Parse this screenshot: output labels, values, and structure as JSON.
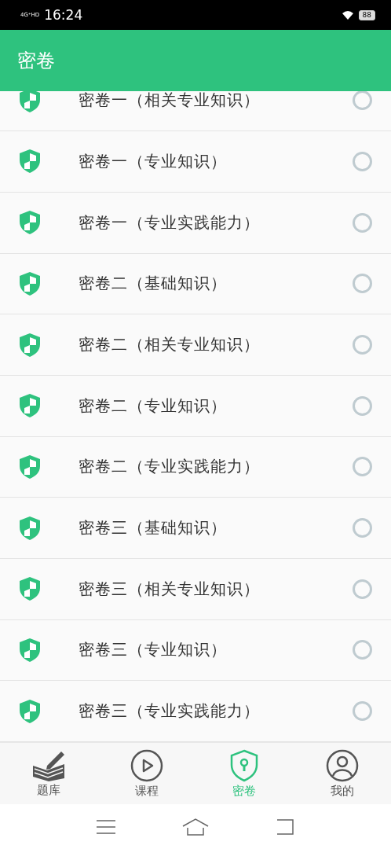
{
  "status_bar": {
    "network": "4G⁺HD",
    "time": "16:24",
    "battery": "88"
  },
  "header": {
    "title": "密卷"
  },
  "papers": [
    {
      "title": "密卷一（相关专业知识）",
      "selected": false
    },
    {
      "title": "密卷一（专业知识）",
      "selected": false
    },
    {
      "title": "密卷一（专业实践能力）",
      "selected": false
    },
    {
      "title": "密卷二（基础知识）",
      "selected": false
    },
    {
      "title": "密卷二（相关专业知识）",
      "selected": false
    },
    {
      "title": "密卷二（专业知识）",
      "selected": false
    },
    {
      "title": "密卷二（专业实践能力）",
      "selected": false
    },
    {
      "title": "密卷三（基础知识）",
      "selected": false
    },
    {
      "title": "密卷三（相关专业知识）",
      "selected": false
    },
    {
      "title": "密卷三（专业知识）",
      "selected": false
    },
    {
      "title": "密卷三（专业实践能力）",
      "selected": false
    }
  ],
  "bottom_nav": [
    {
      "kind": "book",
      "label": "题库",
      "selected": false
    },
    {
      "kind": "play",
      "label": "课程",
      "selected": false
    },
    {
      "kind": "shield",
      "label": "密卷",
      "selected": true
    },
    {
      "kind": "user",
      "label": "我的",
      "selected": false
    }
  ]
}
